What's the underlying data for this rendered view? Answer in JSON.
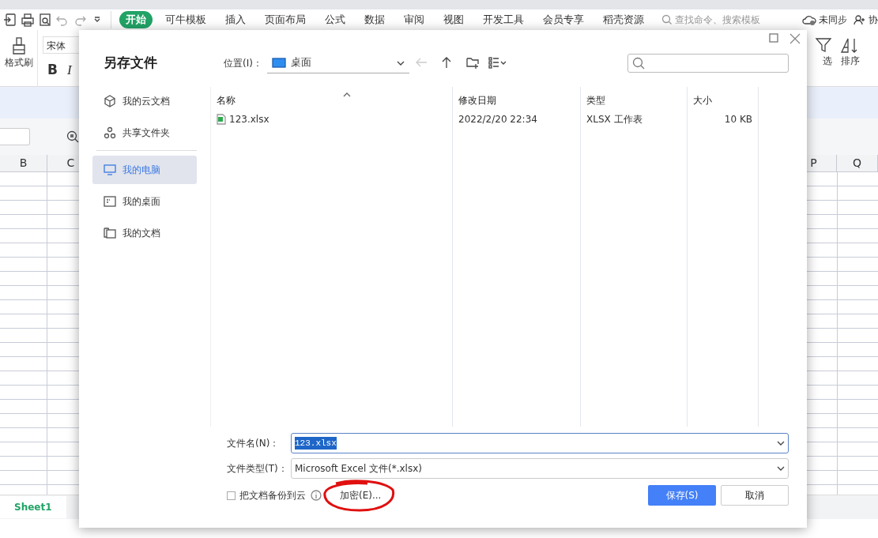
{
  "app": {
    "tabs": [
      {
        "label": "开始",
        "selected": true
      },
      {
        "label": "可牛模板",
        "selected": false
      },
      {
        "label": "插入",
        "selected": false
      },
      {
        "label": "页面布局",
        "selected": false
      },
      {
        "label": "公式",
        "selected": false
      },
      {
        "label": "数据",
        "selected": false
      },
      {
        "label": "审阅",
        "selected": false
      },
      {
        "label": "视图",
        "selected": false
      },
      {
        "label": "开发工具",
        "selected": false
      },
      {
        "label": "会员专享",
        "selected": false
      },
      {
        "label": "稻壳资源",
        "selected": false
      }
    ],
    "search": {
      "placeholder": "查找命令、搜索模板"
    },
    "sync": "未同步",
    "collab": "协",
    "ribbon": {
      "format_painter": "格式刷",
      "font": "宋体",
      "bold": "B",
      "italic": "I",
      "filter": "选",
      "sort": "排序"
    },
    "columns_left": [
      "B",
      "C"
    ],
    "columns_right": [
      "P",
      "Q"
    ],
    "sheet_tab": "Sheet1"
  },
  "dialog": {
    "title": "另存文件",
    "location_label": "位置(I)：",
    "location": "桌面",
    "back_disabled": true,
    "sidebar": [
      {
        "kind": "item",
        "label": "我的云文档",
        "selected": false
      },
      {
        "kind": "item",
        "label": "共享文件夹",
        "selected": false
      },
      {
        "kind": "divider"
      },
      {
        "kind": "item",
        "label": "我的电脑",
        "selected": true
      },
      {
        "kind": "item",
        "label": "我的桌面",
        "selected": false
      },
      {
        "kind": "item",
        "label": "我的文档",
        "selected": false
      }
    ],
    "table": {
      "columns": [
        "名称",
        "修改日期",
        "类型",
        "大小"
      ],
      "rows": [
        [
          "123.xlsx",
          "2022/2/20 22:34",
          "XLSX 工作表",
          "10 KB"
        ]
      ]
    },
    "filename_label": "文件名(N)：",
    "filename": "123.xlsx",
    "filetype_label": "文件类型(T)：",
    "filetype": "Microsoft Excel 文件(*.xlsx)",
    "backup": {
      "label": "把文档备份到云",
      "checked": false
    },
    "encrypt": "加密(E)...",
    "save": "保存(S)",
    "cancel": "取消"
  }
}
